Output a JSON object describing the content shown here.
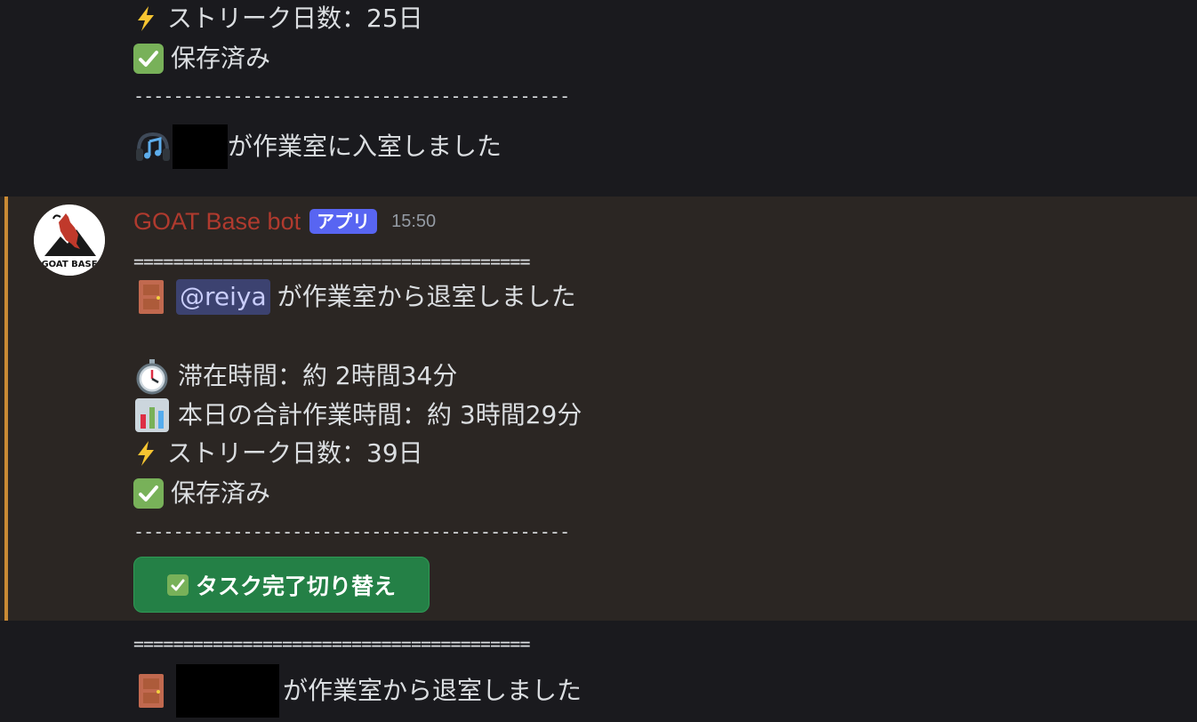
{
  "messages": {
    "prev": {
      "streak": "ストリーク日数：25日",
      "saved": "保存済み",
      "separator": "--------------------------------------------",
      "entered": "が作業室に入室しました"
    },
    "bot": {
      "author": "GOAT Base bot",
      "badge": "アプリ",
      "timestamp": "15:50",
      "separator_top": "========================================",
      "mention": "@reiya",
      "exited": "が作業室から退室しました",
      "stay": "滞在時間：約 2時間34分",
      "total": "本日の合計作業時間：約 3時間29分",
      "streak": "ストリーク日数：39日",
      "saved": "保存済み",
      "separator_bottom": "--------------------------------------------",
      "button_label": "タスク完了切り替え"
    },
    "next": {
      "separator_top": "========================================",
      "exited": "が作業室から退室しました"
    }
  },
  "avatar": {
    "label": "GOAT BASE"
  },
  "icons": {
    "streak": "lightning-icon",
    "saved": "check-mark-icon",
    "entered": "headphones-icon",
    "exited": "door-icon",
    "stay": "stopwatch-icon",
    "total": "bar-chart-icon"
  },
  "colors": {
    "author": "#b03a2e",
    "badge": "#5865f2",
    "button": "#248046",
    "highlight_bar": "#c98a34",
    "mention_bg": "#3c4270"
  }
}
